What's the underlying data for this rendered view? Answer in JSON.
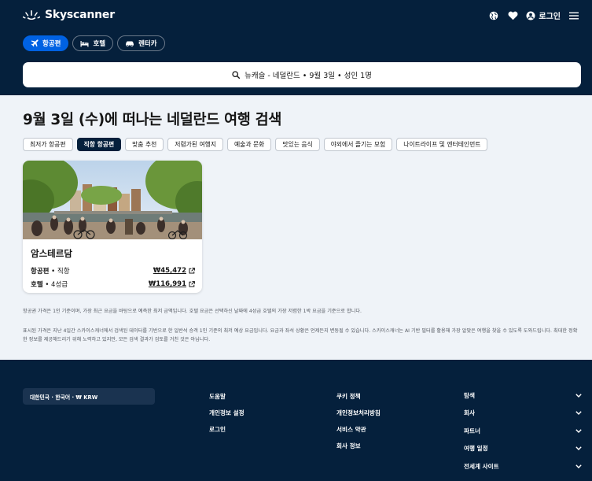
{
  "header": {
    "logo_text": "Skyscanner",
    "login_label": "로그인",
    "tabs": [
      {
        "label": "항공편",
        "icon": "plane-icon",
        "active": true
      },
      {
        "label": "호텔",
        "icon": "bed-icon",
        "active": false
      },
      {
        "label": "렌터카",
        "icon": "car-icon",
        "active": false
      }
    ],
    "search_summary": "뉴캐슬 - 네덜란드 • 9월 3일 • 성인 1명"
  },
  "main": {
    "title": "9월 3일 (수)에 떠나는 네덜란드 여행 검색",
    "filters": [
      {
        "label": "최저가 항공편",
        "active": false
      },
      {
        "label": "직항 항공편",
        "active": true
      },
      {
        "label": "맞춤 추천",
        "active": false
      },
      {
        "label": "저렴가된 여행지",
        "active": false
      },
      {
        "label": "예술과 문화",
        "active": false
      },
      {
        "label": "맛있는 음식",
        "active": false
      },
      {
        "label": "야외에서 즐기는 모험",
        "active": false
      },
      {
        "label": "나이트라이프 및 엔터테인먼트",
        "active": false
      }
    ],
    "card": {
      "city": "암스테르담",
      "flight_label": "항공편",
      "flight_detail": " • 직항",
      "flight_price": "₩45,472",
      "hotel_label": "호텔",
      "hotel_detail": " • 4성급",
      "hotel_price": "₩116,991"
    },
    "note_1": "항공권 가격은 1인 기준이며, 가장 최근 요금을 바탕으로 예측한 최저 금액입니다. 호텔 요금은 선택하신 날짜에 4성급 호텔의 가장 저렴한 1박 요금을 기준으로 합니다.",
    "note_2": "표시된 가격은 지난 4일간 스카이스캐너에서 검색된 데이터를 기반으로 한 일반석 승객 1인 기준의 최저 예상 요금입니다. 요금과 좌석 상황은 언제든지 변동될 수 있습니다. 스카이스캐너는 AI 기반 필터를 활용해 가장 알맞은 여행을 찾을 수 있도록 도와드립니다. 최대한 정확한 정보를 제공해드리기 위해 노력하고 있지만, 모든 검색 결과가 검토를 거친 것은 아닙니다."
  },
  "footer": {
    "locale": "대한민국 · 한국어 · ₩ KRW",
    "col1": [
      "도움말",
      "개인정보 설정",
      "로그인"
    ],
    "col2": [
      "쿠키 정책",
      "개인정보처리방침",
      "서비스 약관",
      "회사 정보"
    ],
    "accordions": [
      "탐색",
      "회사",
      "파트너",
      "여행 일정",
      "전세계 사이트"
    ]
  },
  "colors": {
    "header_bg": "#05203c",
    "accent": "#0062e3",
    "page_bg": "#eff3f8"
  }
}
